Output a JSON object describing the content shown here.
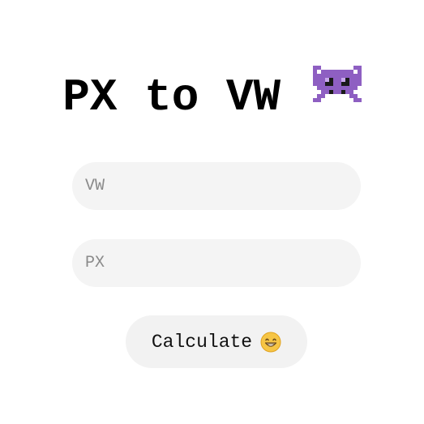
{
  "header": {
    "title": "PX to VW",
    "title_icon": "alien-monster-icon",
    "title_icon_color": "#8e5fc2"
  },
  "form": {
    "vw_placeholder": "VW",
    "vw_value": "",
    "px_placeholder": "PX",
    "px_value": ""
  },
  "actions": {
    "calculate_label": "Calculate",
    "calculate_icon": "grinning-face-icon"
  },
  "colors": {
    "field_background": "#f4f4f4",
    "button_background": "#f2f2f2",
    "placeholder": "#8a8a8a"
  }
}
